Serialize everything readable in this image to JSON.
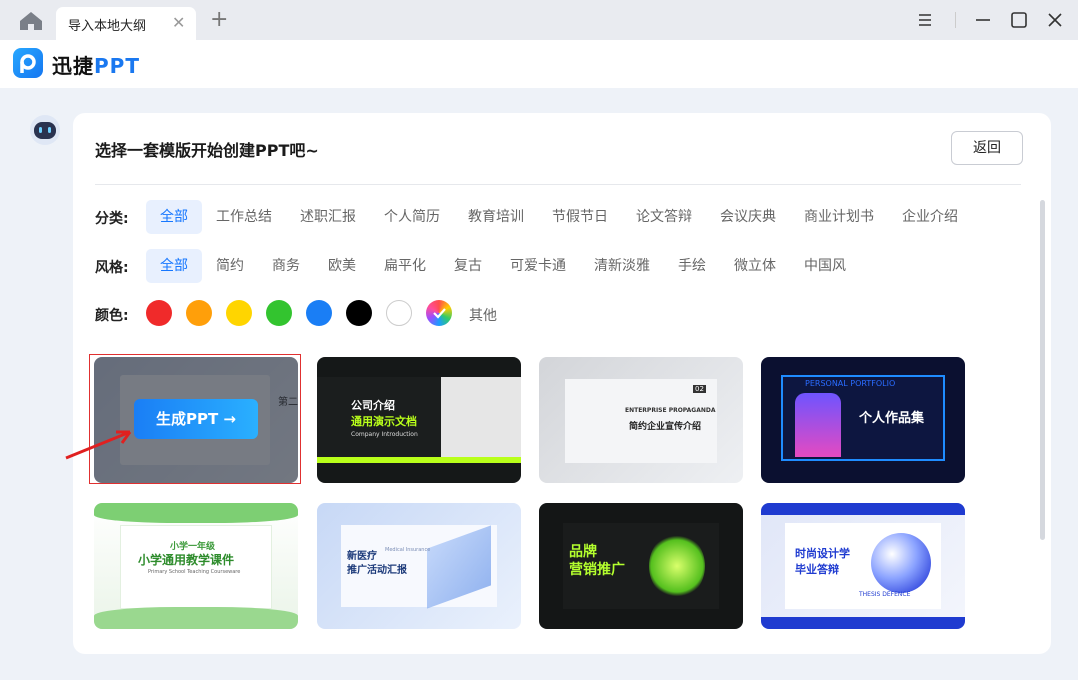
{
  "tab": {
    "title": "导入本地大纲"
  },
  "app": {
    "name_cn": "迅捷",
    "name_en": "PPT"
  },
  "main": {
    "title": "选择一套模版开始创建PPT吧~",
    "back_label": "返回"
  },
  "filters": {
    "category_label": "分类:",
    "categories": [
      "全部",
      "工作总结",
      "述职汇报",
      "个人简历",
      "教育培训",
      "节假节日",
      "论文答辩",
      "会议庆典",
      "商业计划书",
      "企业介绍"
    ],
    "style_label": "风格:",
    "styles": [
      "全部",
      "简约",
      "商务",
      "欧美",
      "扁平化",
      "复古",
      "可爱卡通",
      "清新淡雅",
      "手绘",
      "微立体",
      "中国风"
    ],
    "color_label": "颜色:",
    "colors": [
      "#f02a2a",
      "#ff9f0a",
      "#ffd500",
      "#33c42f",
      "#1a7ef5",
      "#000000",
      "#ffffff",
      "rainbow"
    ],
    "other_label": "其他"
  },
  "templates": [
    {
      "id": "t1",
      "generate_label": "生成PPT →",
      "subtitle": "第二"
    },
    {
      "id": "t2",
      "title": "公司介绍",
      "subtitle": "通用演示文档",
      "en": "Company Introduction"
    },
    {
      "id": "t3",
      "title": "ENTERPRISE PROPAGANDA",
      "subtitle": "简约企业宣传介绍",
      "badge": "02"
    },
    {
      "id": "t4",
      "title": "个人作品集",
      "en": "PERSONAL PORTFOLIO"
    },
    {
      "id": "t5",
      "title": "小学一年级",
      "subtitle": "小学通用教学课件",
      "en": "Primary School Teaching Courseware"
    },
    {
      "id": "t6",
      "title": "新医疗",
      "subtitle": "推广活动汇报",
      "en": "Medical Insurance"
    },
    {
      "id": "t7",
      "title": "品牌",
      "subtitle": "营销推广"
    },
    {
      "id": "t8",
      "title": "时尚设计学",
      "subtitle": "毕业答辩",
      "en": "THESIS DEFENCE"
    }
  ]
}
